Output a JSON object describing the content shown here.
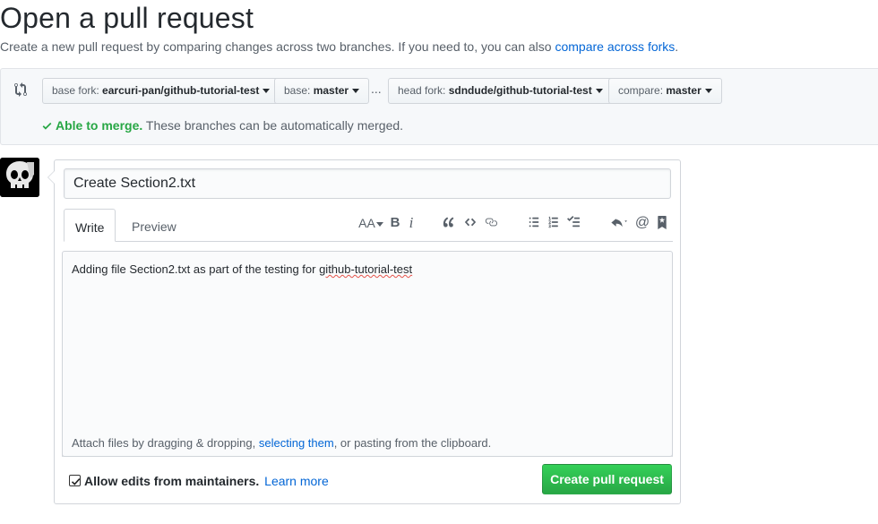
{
  "header": {
    "title": "Open a pull request",
    "description": "Create a new pull request by comparing changes across two branches. If you need to, you can also ",
    "compare_forks_link": "compare across forks",
    "description_end": "."
  },
  "range": {
    "base_fork_label": "base fork:",
    "base_fork_value": "earcuri-pan/github-tutorial-test",
    "base_label": "base:",
    "base_value": "master",
    "dots": "...",
    "head_fork_label": "head fork:",
    "head_fork_value": "sdndude/github-tutorial-test",
    "compare_label": "compare:",
    "compare_value": "master",
    "merge_status_ok": "Able to merge.",
    "merge_status_text": "These branches can be automatically merged."
  },
  "form": {
    "title_value": "Create Section2.txt",
    "tabs": [
      {
        "label": "Write"
      },
      {
        "label": "Preview"
      }
    ],
    "body_prefix": "Adding file ",
    "body_file": "Section2.txt",
    "body_middle": " as part of the testing for ",
    "body_repo": "github-tutorial-test",
    "attach_prefix": "Attach files by dragging & dropping, ",
    "attach_link": "selecting them",
    "attach_suffix": ", or pasting from the clipboard.",
    "allow_edits_label": "Allow edits from maintainers.",
    "allow_edits_checked": true,
    "learn_more_link": "Learn more",
    "submit_label": "Create pull request"
  },
  "toolbar": {
    "icons": [
      "text-size-icon",
      "bold-icon",
      "italic-icon",
      "quote-icon",
      "code-icon",
      "link-icon",
      "unordered-list-icon",
      "ordered-list-icon",
      "task-list-icon",
      "reply-icon",
      "mention-icon",
      "bookmark-icon"
    ],
    "text_size_glyph": "AA",
    "bold_glyph": "B",
    "italic_glyph": "i",
    "mention_glyph": "@"
  },
  "colors": {
    "link": "#0366d6",
    "merge_ok": "#28a745",
    "primary_button": "#28a745"
  }
}
